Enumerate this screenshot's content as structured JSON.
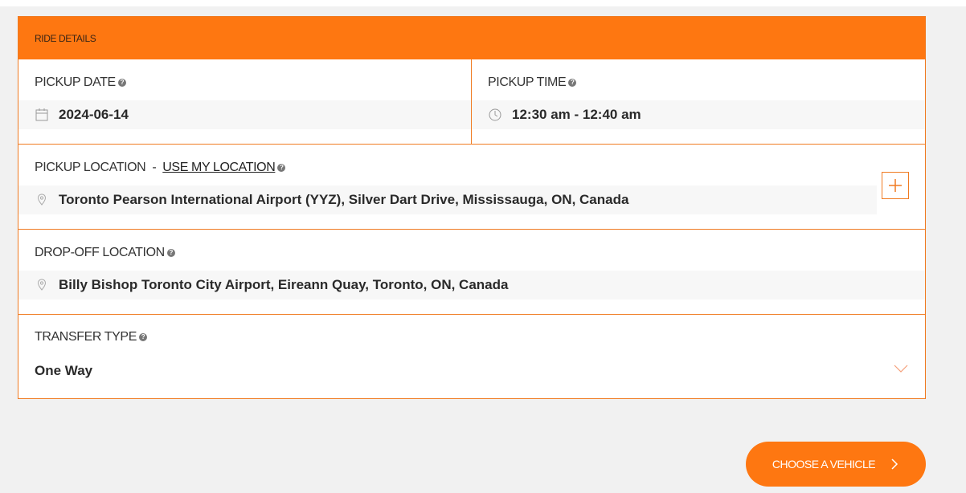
{
  "panel": {
    "title": "RIDE DETAILS",
    "pickup_date": {
      "label": "PICKUP DATE",
      "value": "2024-06-14",
      "icon": "calendar-icon"
    },
    "pickup_time": {
      "label": "PICKUP TIME",
      "value": "12:30 am - 12:40 am",
      "icon": "clock-icon"
    },
    "pickup_location": {
      "label": "PICKUP LOCATION",
      "separator": "-",
      "link": "USE MY LOCATION",
      "value": "Toronto Pearson International Airport (YYZ), Silver Dart Drive, Mississauga, ON, Canada",
      "icon": "location-pin-icon",
      "add_icon": "plus-icon"
    },
    "dropoff_location": {
      "label": "DROP-OFF LOCATION",
      "value": "Billy Bishop Toronto City Airport, Eireann Quay, Toronto, ON, Canada",
      "icon": "location-pin-icon"
    },
    "transfer_type": {
      "label": "TRANSFER TYPE",
      "value": "One Way",
      "icon": "chevron-down-icon"
    }
  },
  "cta": {
    "label": "CHOOSE A VEHICLE",
    "icon": "chevron-right-icon"
  },
  "colors": {
    "accent": "#fe7711",
    "border": "#f07b22",
    "background": "#f1f1f1"
  }
}
